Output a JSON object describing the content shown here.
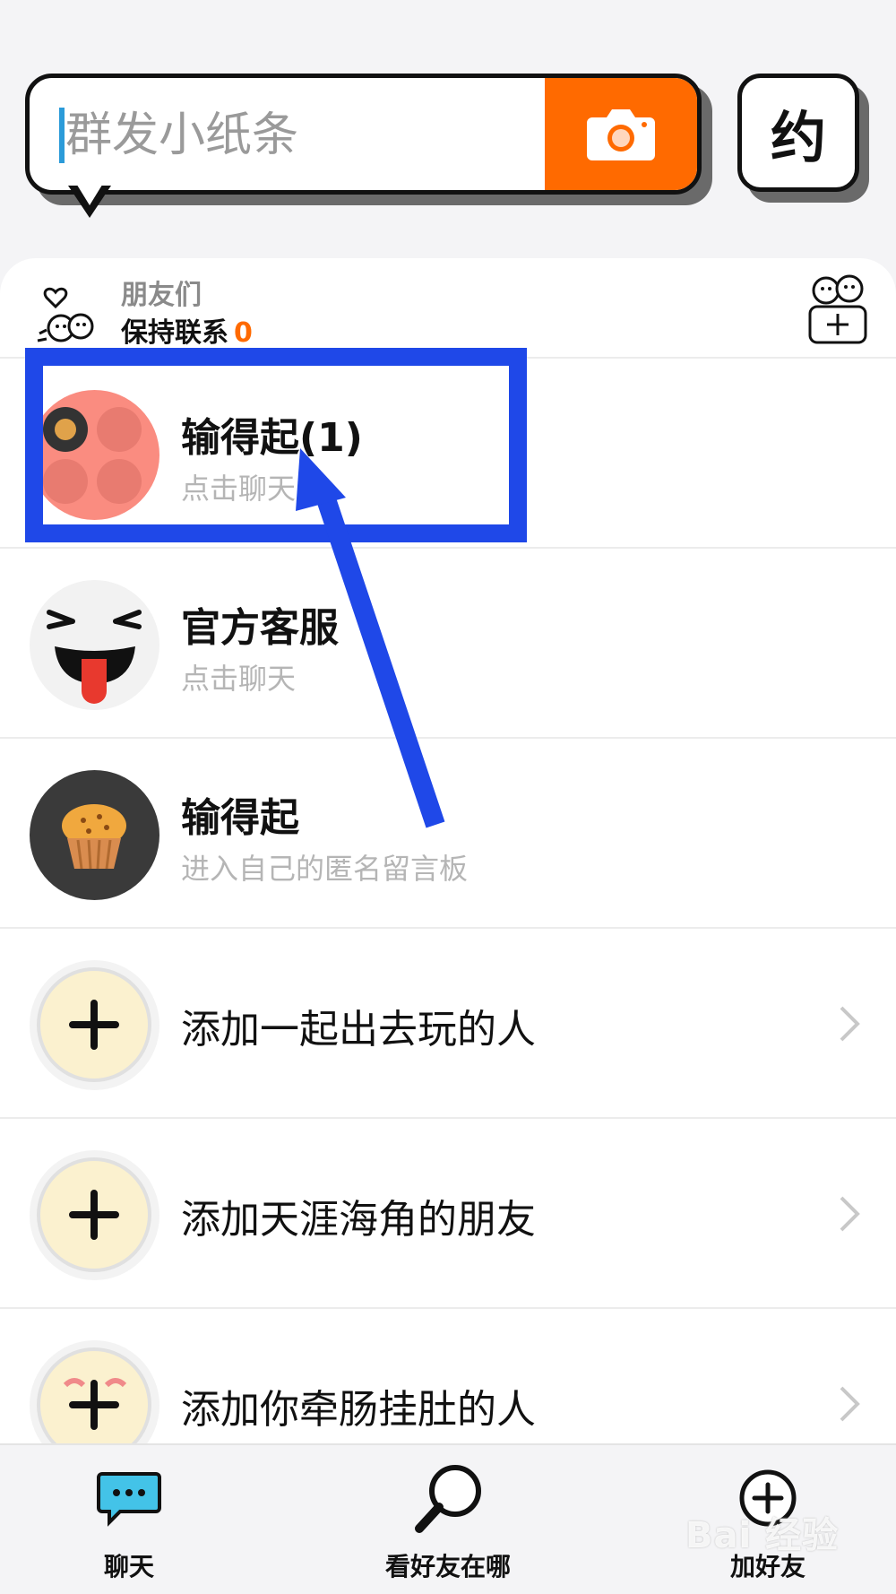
{
  "top": {
    "search_placeholder": "群发小纸条",
    "camera_icon": "camera-icon",
    "yue_label": "约"
  },
  "friends": {
    "title": "朋友们",
    "subtitle": "保持联系",
    "count": "0"
  },
  "chats": [
    {
      "name": "输得起(1)",
      "sub": "点击聊天"
    },
    {
      "name": "官方客服",
      "sub": "点击聊天"
    },
    {
      "name": "输得起",
      "sub": "进入自己的匿名留言板"
    }
  ],
  "add_items": [
    {
      "label": "添加一起出去玩的人"
    },
    {
      "label": "添加天涯海角的朋友"
    },
    {
      "label": "添加你牵肠挂肚的人"
    }
  ],
  "nav": {
    "chat": "聊天",
    "map": "看好友在哪",
    "add": "加好友"
  },
  "colors": {
    "accent": "#ff6a00",
    "annotation": "#1f48e8"
  },
  "watermark": "Bai 经验"
}
